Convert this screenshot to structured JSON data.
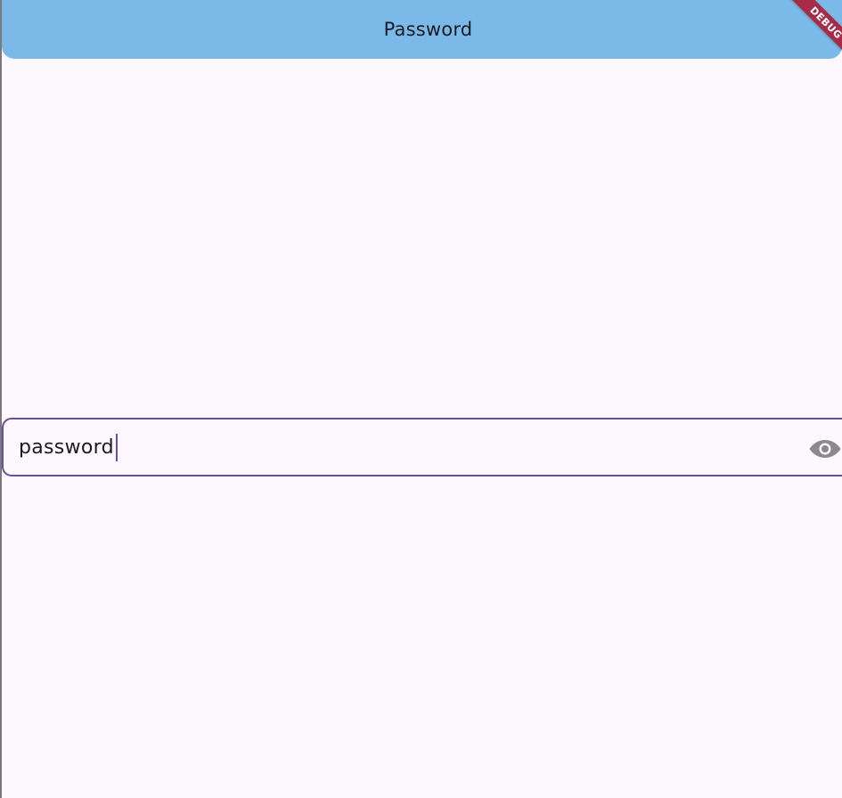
{
  "app_bar": {
    "title": "Password"
  },
  "debug_banner": {
    "label": "DEBUG"
  },
  "password_field": {
    "value": "password",
    "visibility_toggle_icon": "eye-icon"
  },
  "colors": {
    "background": "#fdf7fe",
    "app_bar": "#7bb9e9",
    "field_border": "#6750a4",
    "text": "#1c1b21",
    "icon": "#8a8a8a",
    "debug_ribbon": "#a72c46"
  }
}
